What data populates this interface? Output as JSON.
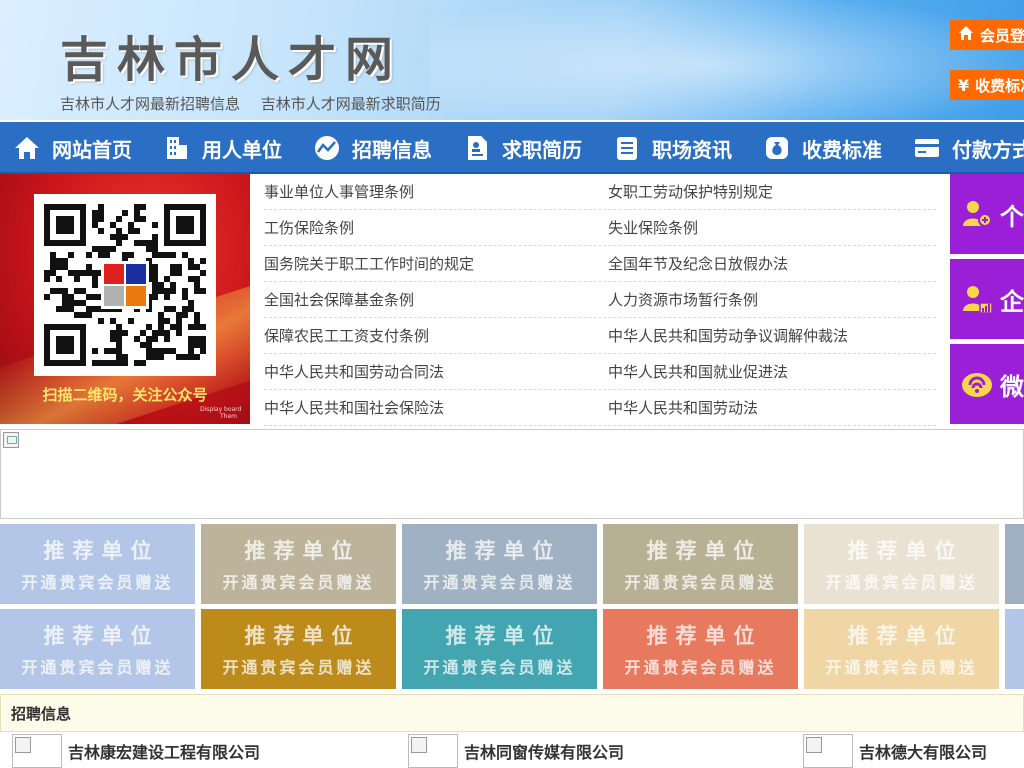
{
  "header": {
    "site_title": "吉林市人才网",
    "sub_link_jobs": "吉林市人才网最新招聘信息",
    "sub_link_resumes": "吉林市人才网最新求职简历",
    "member_login": "会员登录",
    "fee_standard": "收费标准",
    "accent_color": "#ff6a00"
  },
  "nav": {
    "items": [
      {
        "label": "网站首页",
        "icon": "home-icon"
      },
      {
        "label": "用人单位",
        "icon": "building-icon"
      },
      {
        "label": "招聘信息",
        "icon": "chart-icon"
      },
      {
        "label": "求职简历",
        "icon": "resume-icon"
      },
      {
        "label": "职场资讯",
        "icon": "news-icon"
      },
      {
        "label": "收费标准",
        "icon": "moneybag-icon"
      },
      {
        "label": "付款方式",
        "icon": "card-icon"
      }
    ],
    "color": "#2a6fc4"
  },
  "qr": {
    "caption": "扫描二维码，关注公众号",
    "small_text_1": "Display board",
    "small_text_2": "Them"
  },
  "laws": [
    [
      "事业单位人事管理条例",
      "女职工劳动保护特别规定"
    ],
    [
      "工伤保险条例",
      "失业保险条例"
    ],
    [
      "国务院关于职工工作时间的规定",
      "全国年节及纪念日放假办法"
    ],
    [
      "全国社会保障基金条例",
      "人力资源市场暂行条例"
    ],
    [
      "保障农民工工资支付条例",
      "中华人民共和国劳动争议调解仲裁法"
    ],
    [
      "中华人民共和国劳动合同法",
      "中华人民共和国就业促进法"
    ],
    [
      "中华人民共和国社会保险法",
      "中华人民共和国劳动法"
    ]
  ],
  "side_buttons": [
    {
      "label": "个",
      "icon": "person-add-icon"
    },
    {
      "label": "企",
      "icon": "person-chart-icon"
    },
    {
      "label": "微",
      "icon": "wechat-icon"
    }
  ],
  "recommend": {
    "line1": "推荐单位",
    "line2": "开通贵宾会员赠送",
    "row1_colors": [
      "#b3c6e8",
      "#bcb39a",
      "#9fb1c2",
      "#b8b095",
      "#e9e2d3"
    ],
    "row2_colors": [
      "#b3c6e8",
      "#bd8a1c",
      "#42a5b0",
      "#e77a5e",
      "#efd6a4"
    ]
  },
  "jobs": {
    "heading": "招聘信息",
    "companies": [
      "吉林康宏建设工程有限公司",
      "吉林同窗传媒有限公司",
      "吉林德大有限公司"
    ]
  }
}
